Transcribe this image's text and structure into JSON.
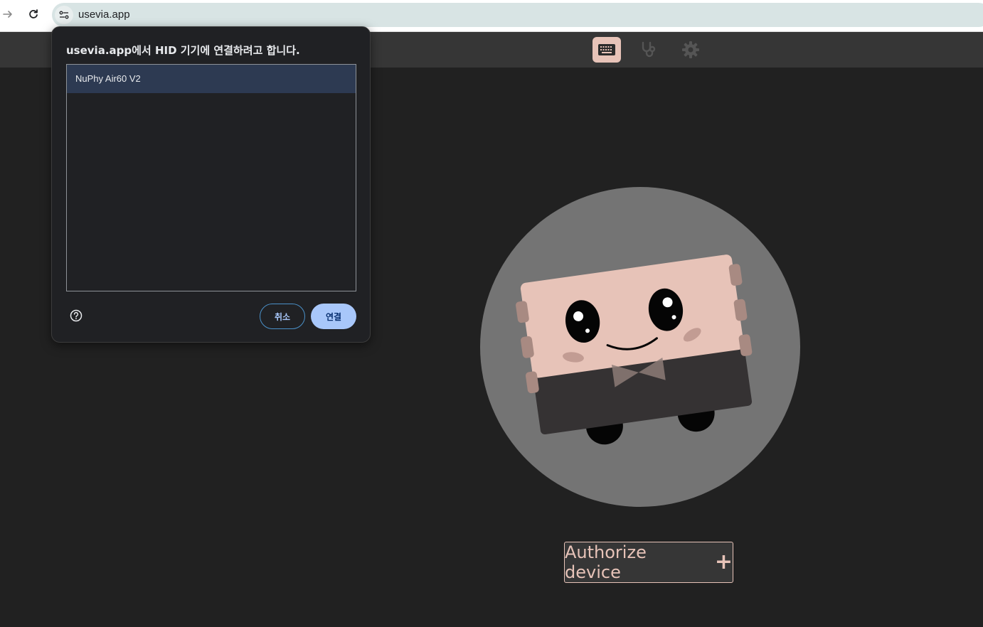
{
  "browser": {
    "url": "usevia.app",
    "icons": [
      "forward-arrow-icon",
      "reload-icon",
      "site-info-icon"
    ]
  },
  "app_header": {
    "icons": [
      "keyboard-icon",
      "stethoscope-icon",
      "gear-icon"
    ],
    "active_tab": "keyboard-icon",
    "accent_color": "#e7c3b8"
  },
  "main": {
    "authorize_label": "Authorize device",
    "authorize_icon": "plus-icon"
  },
  "dialog": {
    "title": "usevia.app에서 HID 기기에 연결하려고 합니다.",
    "devices": [
      {
        "label": "NuPhy Air60 V2",
        "selected": true
      }
    ],
    "help_icon": "help-icon",
    "cancel_label": "취소",
    "connect_label": "연결"
  }
}
